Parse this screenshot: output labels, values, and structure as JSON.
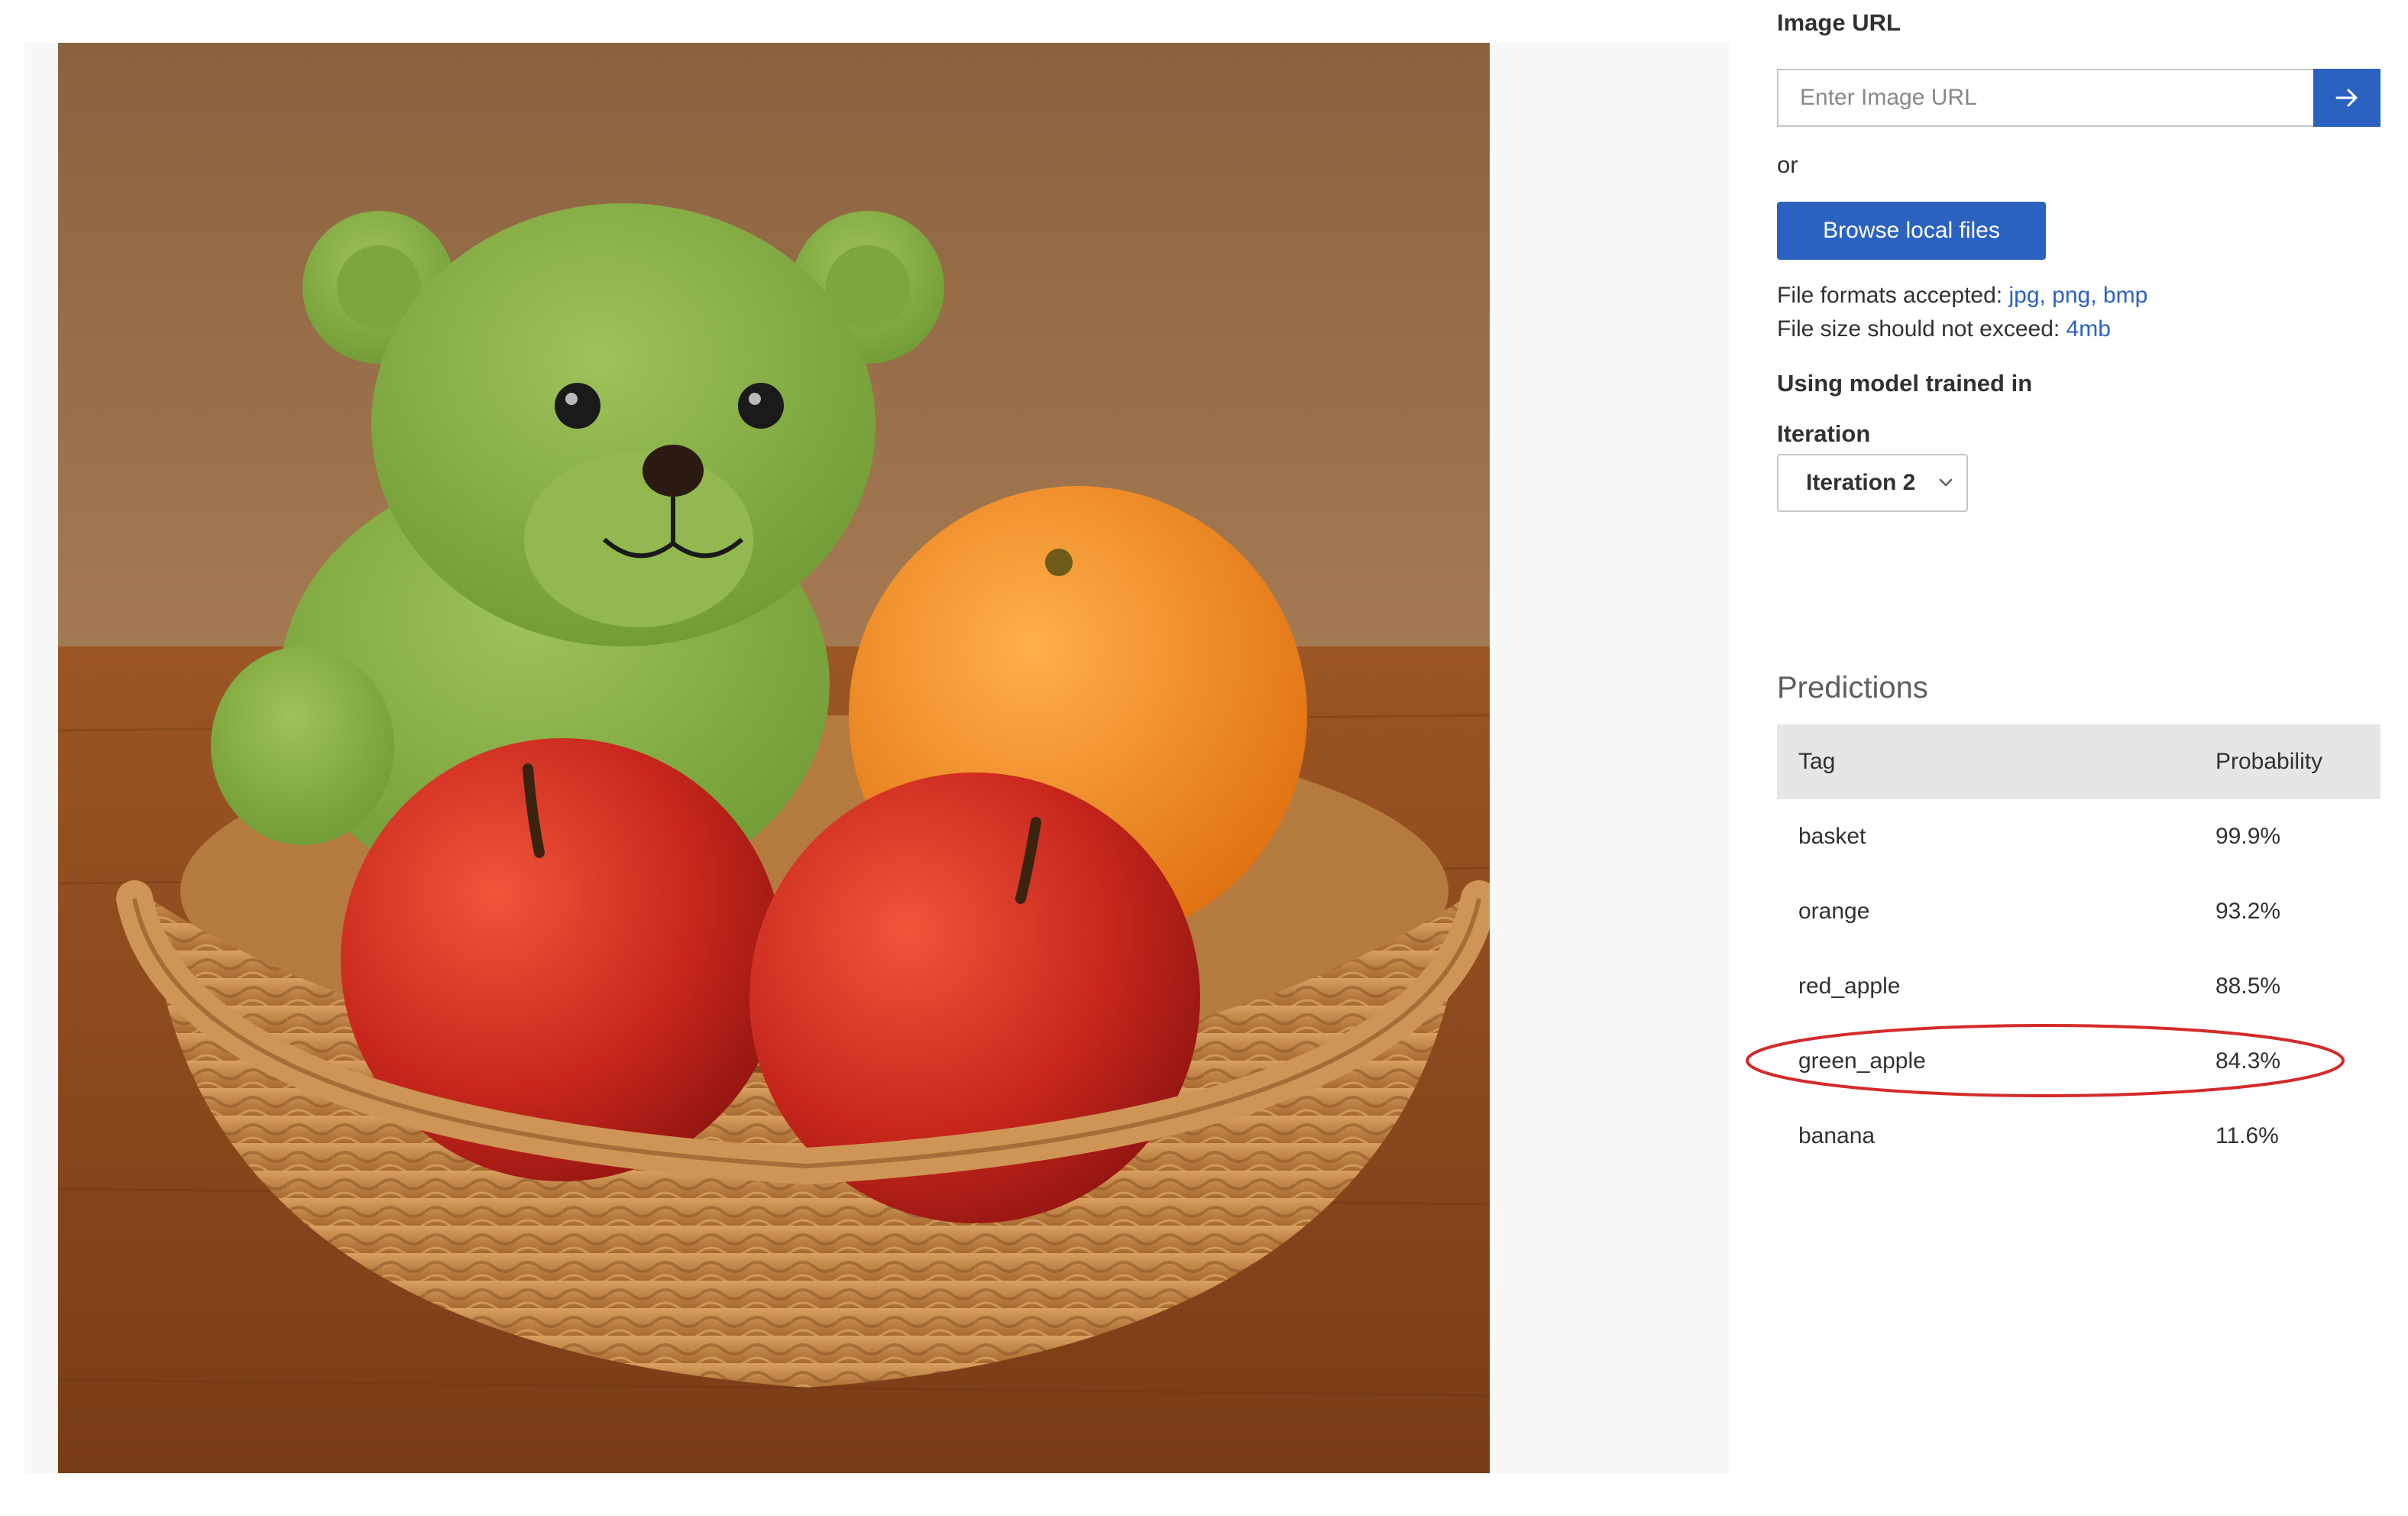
{
  "image_url": {
    "label": "Image URL",
    "placeholder": "Enter Image URL",
    "submit_icon": "arrow-right-icon"
  },
  "or_text": "or",
  "browse_label": "Browse local files",
  "file_info": {
    "formats_label": "File formats accepted: ",
    "formats_value": "jpg, png, bmp",
    "size_label": "File size should not exceed: ",
    "size_value": "4mb"
  },
  "model": {
    "label": "Using model trained in",
    "iteration_label": "Iteration",
    "iteration_value": "Iteration 2"
  },
  "predictions": {
    "title": "Predictions",
    "headers": {
      "tag": "Tag",
      "probability": "Probability"
    },
    "rows": [
      {
        "tag": "basket",
        "probability": "99.9%"
      },
      {
        "tag": "orange",
        "probability": "93.2%"
      },
      {
        "tag": "red_apple",
        "probability": "88.5%"
      },
      {
        "tag": "green_apple",
        "probability": "84.3%",
        "highlighted": true
      },
      {
        "tag": "banana",
        "probability": "11.6%"
      }
    ]
  },
  "colors": {
    "accent": "#2b62c0",
    "highlight_ring": "#d42a2a",
    "table_header_bg": "#e6e6e6"
  }
}
